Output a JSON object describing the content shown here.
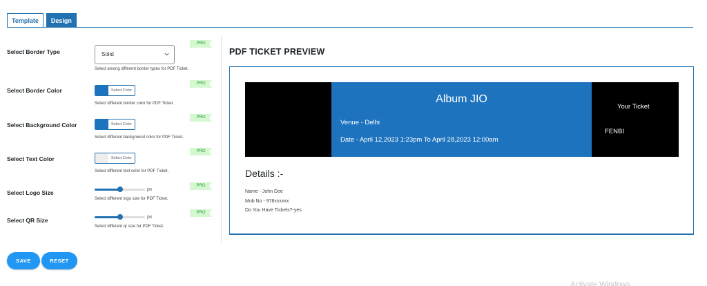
{
  "tabs": {
    "template": "Template",
    "design": "Design"
  },
  "settings": {
    "border_type": {
      "label": "Select Border Type",
      "pro": "PRO",
      "value": "Solid",
      "desc": "Select among different border types for PDF Ticket."
    },
    "border_color": {
      "label": "Select Border Color",
      "pro": "PRO",
      "button": "Select Color",
      "color": "#1e73be",
      "desc": "Select different border color for PDF Ticket."
    },
    "background_color": {
      "label": "Select Background Color",
      "pro": "PRO",
      "button": "Select Color",
      "color": "#1e73be",
      "desc": "Select different background color for PDF Ticket."
    },
    "text_color": {
      "label": "Select Text Color",
      "pro": "PRO",
      "button": "Select Color",
      "color": "#eeeeee",
      "desc": "Select different text color for PDF Ticket."
    },
    "logo_size": {
      "label": "Select Logo Size",
      "pro": "PRO",
      "unit": "px",
      "level": 0.5,
      "desc": "Select different logo size for PDF Ticket."
    },
    "qr_size": {
      "label": "Select QR Size",
      "pro": "PRO",
      "unit": "px",
      "level": 0.5,
      "desc": "Select different qr size for PDF Ticket."
    }
  },
  "preview": {
    "title": "PDF TICKET PREVIEW",
    "ticket": {
      "event_name": "Album JIO",
      "venue": "Venue - Delhi",
      "date": "Date - April 12,2023 1:23pm To April 28,2023 12:00am",
      "your_ticket": "Your Ticket",
      "code": "FENBI"
    },
    "details_title": "Details :-",
    "details": {
      "name": "Name - John Doe",
      "mobile": "Mob No - 978xxxxxx",
      "has_tickets": "Do You Have Tickets?-yes"
    }
  },
  "buttons": {
    "save": "SAVE",
    "reset": "RESET"
  },
  "watermark": "Activate Windows",
  "colors": {
    "accent": "#2271b1",
    "button": "#2196f3",
    "pro_bg": "#d4f8d0",
    "ticket_blue": "#1e73be"
  }
}
